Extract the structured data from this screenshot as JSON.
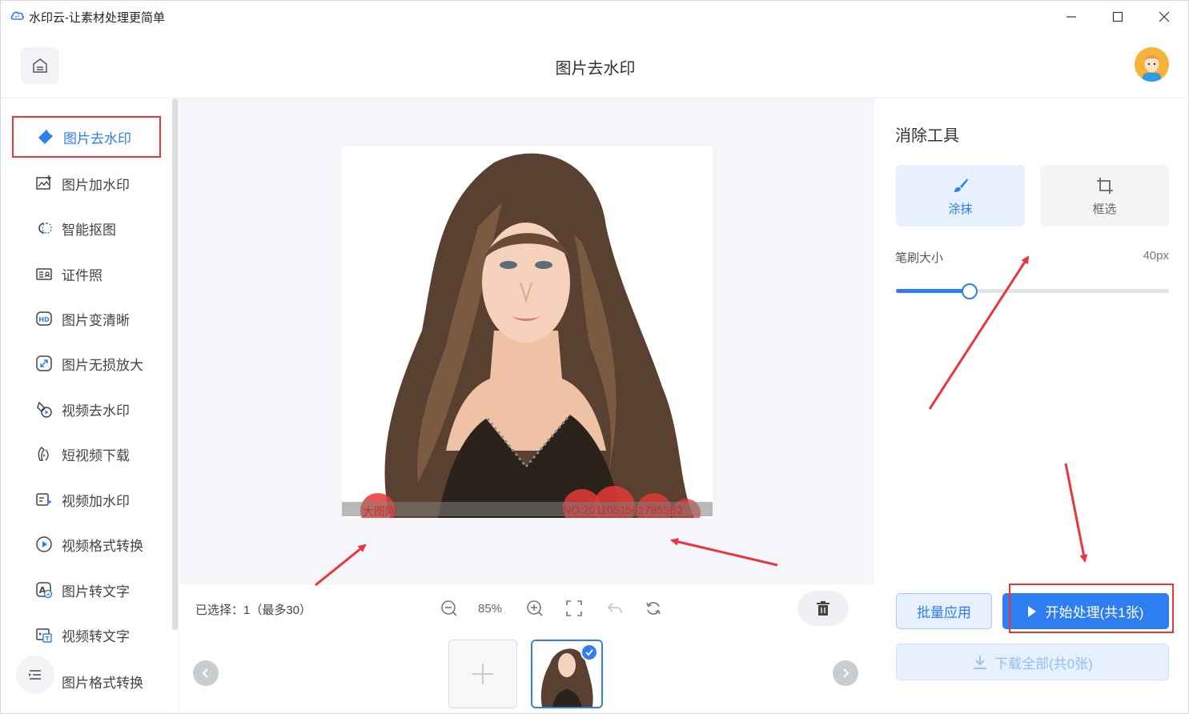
{
  "window": {
    "title": "水印云-让素材处理更简单",
    "icons": [
      "cloud-logo-icon",
      "minimize-icon",
      "maximize-icon",
      "close-icon"
    ]
  },
  "header": {
    "page_title": "图片去水印",
    "home_icon": "home-icon",
    "avatar": "user-avatar"
  },
  "sidebar": {
    "items": [
      {
        "label": "图片去水印",
        "icon": "eraser-icon",
        "active": true
      },
      {
        "label": "图片加水印",
        "icon": "image-add-icon",
        "active": false
      },
      {
        "label": "智能抠图",
        "icon": "cutout-icon",
        "active": false
      },
      {
        "label": "证件照",
        "icon": "id-card-icon",
        "active": false
      },
      {
        "label": "图片变清晰",
        "icon": "hd-icon",
        "active": false
      },
      {
        "label": "图片无损放大",
        "icon": "enlarge-icon",
        "active": false
      },
      {
        "label": "视频去水印",
        "icon": "video-eraser-icon",
        "active": false
      },
      {
        "label": "短视频下载",
        "icon": "video-download-icon",
        "active": false
      },
      {
        "label": "视频加水印",
        "icon": "video-watermark-icon",
        "active": false
      },
      {
        "label": "视频格式转换",
        "icon": "play-circle-icon",
        "active": false
      },
      {
        "label": "图片转文字",
        "icon": "image-text-icon",
        "active": false
      },
      {
        "label": "视频转文字",
        "icon": "video-text-icon",
        "active": false
      },
      {
        "label": "图片格式转换",
        "icon": "image-format-icon",
        "active": false
      }
    ]
  },
  "canvas": {
    "watermark_left": "大图网",
    "watermark_right": "NO:20110515627855B2"
  },
  "toolbar": {
    "selected_info": "已选择：1（最多30）",
    "zoom": "85%",
    "icons": [
      "zoom-out-icon",
      "zoom-in-icon",
      "fit-screen-icon",
      "undo-icon",
      "reset-icon",
      "trash-icon"
    ]
  },
  "panel": {
    "title": "消除工具",
    "modes": [
      {
        "label": "涂抹",
        "icon": "brush-icon",
        "selected": true
      },
      {
        "label": "框选",
        "icon": "crop-icon",
        "selected": false
      }
    ],
    "brush_label": "笔刷大小",
    "brush_value": "40px",
    "brush_level": 0.27,
    "batch_label": "批量应用",
    "start_label": "开始处理(共1张)",
    "download_label": "下载全部(共0张)"
  },
  "colors": {
    "accent": "#2e7ef0",
    "highlight": "#e8363a",
    "canvas_bg": "#f4f6fa"
  }
}
